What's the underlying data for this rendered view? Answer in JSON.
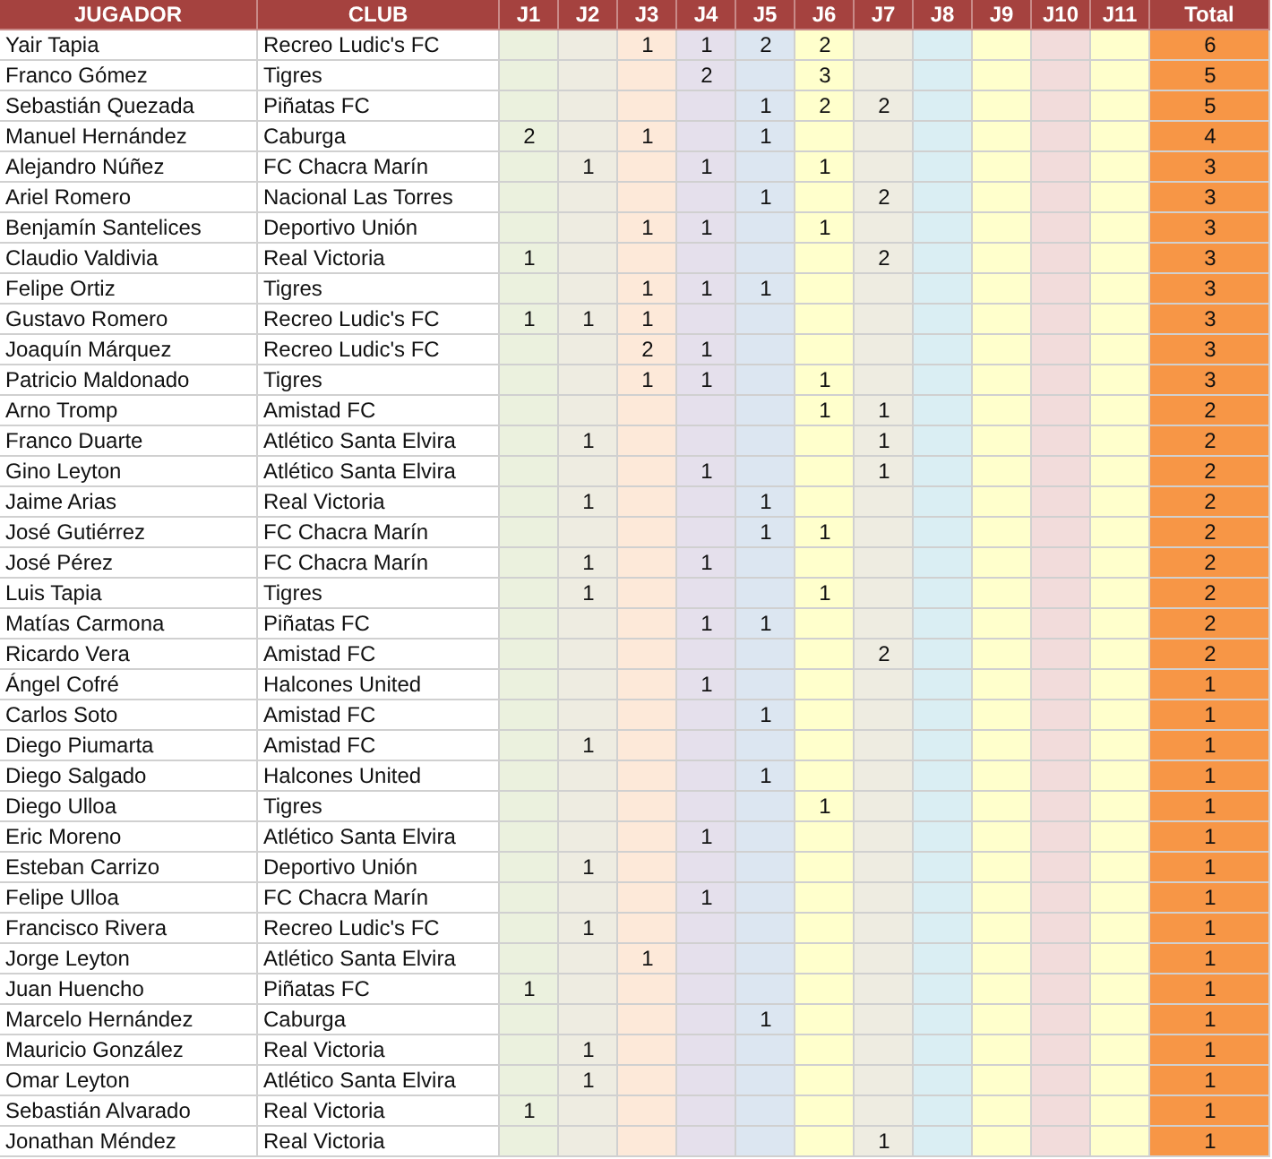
{
  "table": {
    "columns": [
      {
        "label": "JUGADOR"
      },
      {
        "label": "CLUB"
      },
      {
        "label": "J1",
        "color": "#ebf1de"
      },
      {
        "label": "J2",
        "color": "#eeece1"
      },
      {
        "label": "J3",
        "color": "#fde9d9"
      },
      {
        "label": "J4",
        "color": "#e5e0ec"
      },
      {
        "label": "J5",
        "color": "#dce6f1"
      },
      {
        "label": "J6",
        "color": "#ffffcc"
      },
      {
        "label": "J7",
        "color": "#eeece1"
      },
      {
        "label": "J8",
        "color": "#daeef3"
      },
      {
        "label": "J9",
        "color": "#ffffcc"
      },
      {
        "label": "J10",
        "color": "#f2dcdb"
      },
      {
        "label": "J11",
        "color": "#ffffcc"
      },
      {
        "label": "Total",
        "color": "#f79646"
      }
    ],
    "rows": [
      {
        "player": "Yair Tapia",
        "club": "Recreo Ludic's FC",
        "goals": [
          {
            "kind": "blank"
          },
          {
            "kind": "blank"
          },
          {
            "kind": "goals",
            "value": "1"
          },
          {
            "kind": "goals",
            "value": "1"
          },
          {
            "kind": "goals",
            "value": "2"
          },
          {
            "kind": "goals",
            "value": "2"
          },
          {
            "kind": "blank"
          },
          {
            "kind": "blank"
          },
          {
            "kind": "blank"
          },
          {
            "kind": "blank"
          },
          {
            "kind": "blank"
          }
        ],
        "total": "6"
      },
      {
        "player": "Franco Gómez",
        "club": "Tigres",
        "goals": [
          {
            "kind": "blank"
          },
          {
            "kind": "blank"
          },
          {
            "kind": "blank"
          },
          {
            "kind": "goals",
            "value": "2"
          },
          {
            "kind": "blank"
          },
          {
            "kind": "goals",
            "value": "3"
          },
          {
            "kind": "blank"
          },
          {
            "kind": "blank"
          },
          {
            "kind": "blank"
          },
          {
            "kind": "blank"
          },
          {
            "kind": "blank"
          }
        ],
        "total": "5"
      },
      {
        "player": "Sebastián Quezada",
        "club": "Piñatas FC",
        "goals": [
          {
            "kind": "blank"
          },
          {
            "kind": "blank"
          },
          {
            "kind": "blank"
          },
          {
            "kind": "blank"
          },
          {
            "kind": "goals",
            "value": "1"
          },
          {
            "kind": "goals",
            "value": "2"
          },
          {
            "kind": "goals",
            "value": "2"
          },
          {
            "kind": "blank"
          },
          {
            "kind": "blank"
          },
          {
            "kind": "blank"
          },
          {
            "kind": "blank"
          }
        ],
        "total": "5"
      },
      {
        "player": "Manuel Hernández",
        "club": "Caburga",
        "goals": [
          {
            "kind": "goals",
            "value": "2"
          },
          {
            "kind": "blank"
          },
          {
            "kind": "goals",
            "value": "1"
          },
          {
            "kind": "blank"
          },
          {
            "kind": "goals",
            "value": "1"
          },
          {
            "kind": "blank"
          },
          {
            "kind": "blank"
          },
          {
            "kind": "blank"
          },
          {
            "kind": "blank"
          },
          {
            "kind": "blank"
          },
          {
            "kind": "blank"
          }
        ],
        "total": "4"
      },
      {
        "player": "Alejandro Núñez",
        "club": "FC Chacra Marín",
        "goals": [
          {
            "kind": "blank"
          },
          {
            "kind": "goals",
            "value": "1"
          },
          {
            "kind": "blank"
          },
          {
            "kind": "goals",
            "value": "1"
          },
          {
            "kind": "blank"
          },
          {
            "kind": "goals",
            "value": "1"
          },
          {
            "kind": "blank"
          },
          {
            "kind": "blank"
          },
          {
            "kind": "blank"
          },
          {
            "kind": "blank"
          },
          {
            "kind": "blank"
          }
        ],
        "total": "3"
      },
      {
        "player": "Ariel Romero",
        "club": "Nacional Las Torres",
        "goals": [
          {
            "kind": "blank"
          },
          {
            "kind": "blank"
          },
          {
            "kind": "blank"
          },
          {
            "kind": "blank"
          },
          {
            "kind": "goals",
            "value": "1"
          },
          {
            "kind": "blank"
          },
          {
            "kind": "goals",
            "value": "2"
          },
          {
            "kind": "blank"
          },
          {
            "kind": "blank"
          },
          {
            "kind": "blank"
          },
          {
            "kind": "blank"
          }
        ],
        "total": "3"
      },
      {
        "player": "Benjamín Santelices",
        "club": "Deportivo Unión",
        "goals": [
          {
            "kind": "blank"
          },
          {
            "kind": "blank"
          },
          {
            "kind": "goals",
            "value": "1"
          },
          {
            "kind": "goals",
            "value": "1"
          },
          {
            "kind": "blank"
          },
          {
            "kind": "goals",
            "value": "1"
          },
          {
            "kind": "blank"
          },
          {
            "kind": "blank"
          },
          {
            "kind": "blank"
          },
          {
            "kind": "blank"
          },
          {
            "kind": "blank"
          }
        ],
        "total": "3"
      },
      {
        "player": "Claudio Valdivia",
        "club": "Real Victoria",
        "goals": [
          {
            "kind": "goals",
            "value": "1"
          },
          {
            "kind": "blank"
          },
          {
            "kind": "blank"
          },
          {
            "kind": "blank"
          },
          {
            "kind": "blank"
          },
          {
            "kind": "blank"
          },
          {
            "kind": "goals",
            "value": "2"
          },
          {
            "kind": "blank"
          },
          {
            "kind": "blank"
          },
          {
            "kind": "blank"
          },
          {
            "kind": "blank"
          }
        ],
        "total": "3"
      },
      {
        "player": "Felipe Ortiz",
        "club": "Tigres",
        "goals": [
          {
            "kind": "blank"
          },
          {
            "kind": "blank"
          },
          {
            "kind": "goals",
            "value": "1"
          },
          {
            "kind": "goals",
            "value": "1"
          },
          {
            "kind": "goals",
            "value": "1"
          },
          {
            "kind": "blank"
          },
          {
            "kind": "blank"
          },
          {
            "kind": "blank"
          },
          {
            "kind": "blank"
          },
          {
            "kind": "blank"
          },
          {
            "kind": "blank"
          }
        ],
        "total": "3"
      },
      {
        "player": "Gustavo Romero",
        "club": "Recreo Ludic's FC",
        "goals": [
          {
            "kind": "goals",
            "value": "1"
          },
          {
            "kind": "goals",
            "value": "1"
          },
          {
            "kind": "goals",
            "value": "1"
          },
          {
            "kind": "blank"
          },
          {
            "kind": "blank"
          },
          {
            "kind": "blank"
          },
          {
            "kind": "blank"
          },
          {
            "kind": "blank"
          },
          {
            "kind": "blank"
          },
          {
            "kind": "blank"
          },
          {
            "kind": "blank"
          }
        ],
        "total": "3"
      },
      {
        "player": "Joaquín Márquez",
        "club": "Recreo Ludic's FC",
        "goals": [
          {
            "kind": "blank"
          },
          {
            "kind": "blank"
          },
          {
            "kind": "goals",
            "value": "2"
          },
          {
            "kind": "goals",
            "value": "1"
          },
          {
            "kind": "blank"
          },
          {
            "kind": "blank"
          },
          {
            "kind": "blank"
          },
          {
            "kind": "blank"
          },
          {
            "kind": "blank"
          },
          {
            "kind": "blank"
          },
          {
            "kind": "blank"
          }
        ],
        "total": "3"
      },
      {
        "player": "Patricio Maldonado",
        "club": "Tigres",
        "goals": [
          {
            "kind": "blank"
          },
          {
            "kind": "blank"
          },
          {
            "kind": "goals",
            "value": "1"
          },
          {
            "kind": "goals",
            "value": "1"
          },
          {
            "kind": "blank"
          },
          {
            "kind": "goals",
            "value": "1"
          },
          {
            "kind": "blank"
          },
          {
            "kind": "blank"
          },
          {
            "kind": "blank"
          },
          {
            "kind": "blank"
          },
          {
            "kind": "blank"
          }
        ],
        "total": "3"
      },
      {
        "player": "Arno Tromp",
        "club": "Amistad FC",
        "goals": [
          {
            "kind": "blank"
          },
          {
            "kind": "blank"
          },
          {
            "kind": "blank"
          },
          {
            "kind": "blank"
          },
          {
            "kind": "blank"
          },
          {
            "kind": "goals",
            "value": "1"
          },
          {
            "kind": "goals",
            "value": "1"
          },
          {
            "kind": "blank"
          },
          {
            "kind": "blank"
          },
          {
            "kind": "blank"
          },
          {
            "kind": "blank"
          }
        ],
        "total": "2"
      },
      {
        "player": "Franco Duarte",
        "club": "Atlético Santa Elvira",
        "goals": [
          {
            "kind": "blank"
          },
          {
            "kind": "goals",
            "value": "1"
          },
          {
            "kind": "blank"
          },
          {
            "kind": "blank"
          },
          {
            "kind": "blank"
          },
          {
            "kind": "blank"
          },
          {
            "kind": "goals",
            "value": "1"
          },
          {
            "kind": "blank"
          },
          {
            "kind": "blank"
          },
          {
            "kind": "blank"
          },
          {
            "kind": "blank"
          }
        ],
        "total": "2"
      },
      {
        "player": "Gino Leyton",
        "club": "Atlético Santa Elvira",
        "goals": [
          {
            "kind": "blank"
          },
          {
            "kind": "blank"
          },
          {
            "kind": "blank"
          },
          {
            "kind": "goals",
            "value": "1"
          },
          {
            "kind": "blank"
          },
          {
            "kind": "blank"
          },
          {
            "kind": "goals",
            "value": "1"
          },
          {
            "kind": "blank"
          },
          {
            "kind": "blank"
          },
          {
            "kind": "blank"
          },
          {
            "kind": "blank"
          }
        ],
        "total": "2"
      },
      {
        "player": "Jaime Arias",
        "club": "Real Victoria",
        "goals": [
          {
            "kind": "blank"
          },
          {
            "kind": "goals",
            "value": "1"
          },
          {
            "kind": "blank"
          },
          {
            "kind": "blank"
          },
          {
            "kind": "goals",
            "value": "1"
          },
          {
            "kind": "blank"
          },
          {
            "kind": "blank"
          },
          {
            "kind": "blank"
          },
          {
            "kind": "blank"
          },
          {
            "kind": "blank"
          },
          {
            "kind": "blank"
          }
        ],
        "total": "2"
      },
      {
        "player": "José Gutiérrez",
        "club": "FC Chacra Marín",
        "goals": [
          {
            "kind": "blank"
          },
          {
            "kind": "blank"
          },
          {
            "kind": "blank"
          },
          {
            "kind": "blank"
          },
          {
            "kind": "goals",
            "value": "1"
          },
          {
            "kind": "goals",
            "value": "1"
          },
          {
            "kind": "blank"
          },
          {
            "kind": "blank"
          },
          {
            "kind": "blank"
          },
          {
            "kind": "blank"
          },
          {
            "kind": "blank"
          }
        ],
        "total": "2"
      },
      {
        "player": "José Pérez",
        "club": "FC Chacra Marín",
        "goals": [
          {
            "kind": "blank"
          },
          {
            "kind": "goals",
            "value": "1"
          },
          {
            "kind": "blank"
          },
          {
            "kind": "goals",
            "value": "1"
          },
          {
            "kind": "blank"
          },
          {
            "kind": "blank"
          },
          {
            "kind": "blank"
          },
          {
            "kind": "blank"
          },
          {
            "kind": "blank"
          },
          {
            "kind": "blank"
          },
          {
            "kind": "blank"
          }
        ],
        "total": "2"
      },
      {
        "player": "Luis Tapia",
        "club": "Tigres",
        "goals": [
          {
            "kind": "blank"
          },
          {
            "kind": "goals",
            "value": "1"
          },
          {
            "kind": "blank"
          },
          {
            "kind": "blank"
          },
          {
            "kind": "blank"
          },
          {
            "kind": "goals",
            "value": "1"
          },
          {
            "kind": "blank"
          },
          {
            "kind": "blank"
          },
          {
            "kind": "blank"
          },
          {
            "kind": "blank"
          },
          {
            "kind": "blank"
          }
        ],
        "total": "2"
      },
      {
        "player": "Matías Carmona",
        "club": "Piñatas FC",
        "goals": [
          {
            "kind": "blank"
          },
          {
            "kind": "blank"
          },
          {
            "kind": "blank"
          },
          {
            "kind": "goals",
            "value": "1"
          },
          {
            "kind": "goals",
            "value": "1"
          },
          {
            "kind": "blank"
          },
          {
            "kind": "blank"
          },
          {
            "kind": "blank"
          },
          {
            "kind": "blank"
          },
          {
            "kind": "blank"
          },
          {
            "kind": "blank"
          }
        ],
        "total": "2"
      },
      {
        "player": "Ricardo Vera",
        "club": "Amistad FC",
        "goals": [
          {
            "kind": "blank"
          },
          {
            "kind": "blank"
          },
          {
            "kind": "blank"
          },
          {
            "kind": "blank"
          },
          {
            "kind": "blank"
          },
          {
            "kind": "blank"
          },
          {
            "kind": "goals",
            "value": "2"
          },
          {
            "kind": "blank"
          },
          {
            "kind": "blank"
          },
          {
            "kind": "blank"
          },
          {
            "kind": "blank"
          }
        ],
        "total": "2"
      },
      {
        "player": "Ángel Cofré",
        "club": "Halcones United",
        "goals": [
          {
            "kind": "blank"
          },
          {
            "kind": "blank"
          },
          {
            "kind": "blank"
          },
          {
            "kind": "goals",
            "value": "1"
          },
          {
            "kind": "blank"
          },
          {
            "kind": "blank"
          },
          {
            "kind": "blank"
          },
          {
            "kind": "blank"
          },
          {
            "kind": "blank"
          },
          {
            "kind": "blank"
          },
          {
            "kind": "blank"
          }
        ],
        "total": "1"
      },
      {
        "player": "Carlos Soto",
        "club": "Amistad FC",
        "goals": [
          {
            "kind": "blank"
          },
          {
            "kind": "blank"
          },
          {
            "kind": "blank"
          },
          {
            "kind": "blank"
          },
          {
            "kind": "goals",
            "value": "1"
          },
          {
            "kind": "blank"
          },
          {
            "kind": "blank"
          },
          {
            "kind": "blank"
          },
          {
            "kind": "blank"
          },
          {
            "kind": "blank"
          },
          {
            "kind": "blank"
          }
        ],
        "total": "1"
      },
      {
        "player": "Diego Piumarta",
        "club": "Amistad FC",
        "goals": [
          {
            "kind": "blank"
          },
          {
            "kind": "goals",
            "value": "1"
          },
          {
            "kind": "blank"
          },
          {
            "kind": "blank"
          },
          {
            "kind": "blank"
          },
          {
            "kind": "blank"
          },
          {
            "kind": "blank"
          },
          {
            "kind": "blank"
          },
          {
            "kind": "blank"
          },
          {
            "kind": "blank"
          },
          {
            "kind": "blank"
          }
        ],
        "total": "1"
      },
      {
        "player": "Diego Salgado",
        "club": "Halcones United",
        "goals": [
          {
            "kind": "blank"
          },
          {
            "kind": "blank"
          },
          {
            "kind": "blank"
          },
          {
            "kind": "blank"
          },
          {
            "kind": "goals",
            "value": "1"
          },
          {
            "kind": "blank"
          },
          {
            "kind": "blank"
          },
          {
            "kind": "blank"
          },
          {
            "kind": "blank"
          },
          {
            "kind": "blank"
          },
          {
            "kind": "blank"
          }
        ],
        "total": "1"
      },
      {
        "player": "Diego Ulloa",
        "club": "Tigres",
        "goals": [
          {
            "kind": "blank"
          },
          {
            "kind": "blank"
          },
          {
            "kind": "blank"
          },
          {
            "kind": "blank"
          },
          {
            "kind": "blank"
          },
          {
            "kind": "goals",
            "value": "1"
          },
          {
            "kind": "blank"
          },
          {
            "kind": "blank"
          },
          {
            "kind": "blank"
          },
          {
            "kind": "blank"
          },
          {
            "kind": "blank"
          }
        ],
        "total": "1"
      },
      {
        "player": "Eric Moreno",
        "club": "Atlético Santa Elvira",
        "goals": [
          {
            "kind": "blank"
          },
          {
            "kind": "blank"
          },
          {
            "kind": "blank"
          },
          {
            "kind": "goals",
            "value": "1"
          },
          {
            "kind": "blank"
          },
          {
            "kind": "blank"
          },
          {
            "kind": "blank"
          },
          {
            "kind": "blank"
          },
          {
            "kind": "blank"
          },
          {
            "kind": "blank"
          },
          {
            "kind": "blank"
          }
        ],
        "total": "1"
      },
      {
        "player": "Esteban Carrizo",
        "club": "Deportivo Unión",
        "goals": [
          {
            "kind": "blank"
          },
          {
            "kind": "goals",
            "value": "1"
          },
          {
            "kind": "blank"
          },
          {
            "kind": "blank"
          },
          {
            "kind": "blank"
          },
          {
            "kind": "blank"
          },
          {
            "kind": "blank"
          },
          {
            "kind": "blank"
          },
          {
            "kind": "blank"
          },
          {
            "kind": "blank"
          },
          {
            "kind": "blank"
          }
        ],
        "total": "1"
      },
      {
        "player": "Felipe Ulloa",
        "club": "FC Chacra Marín",
        "goals": [
          {
            "kind": "blank"
          },
          {
            "kind": "blank"
          },
          {
            "kind": "blank"
          },
          {
            "kind": "goals",
            "value": "1"
          },
          {
            "kind": "blank"
          },
          {
            "kind": "blank"
          },
          {
            "kind": "blank"
          },
          {
            "kind": "blank"
          },
          {
            "kind": "blank"
          },
          {
            "kind": "blank"
          },
          {
            "kind": "blank"
          }
        ],
        "total": "1"
      },
      {
        "player": "Francisco Rivera",
        "club": "Recreo Ludic's FC",
        "goals": [
          {
            "kind": "blank"
          },
          {
            "kind": "goals",
            "value": "1"
          },
          {
            "kind": "blank"
          },
          {
            "kind": "blank"
          },
          {
            "kind": "blank"
          },
          {
            "kind": "blank"
          },
          {
            "kind": "blank"
          },
          {
            "kind": "blank"
          },
          {
            "kind": "blank"
          },
          {
            "kind": "blank"
          },
          {
            "kind": "blank"
          }
        ],
        "total": "1"
      },
      {
        "player": "Jorge Leyton",
        "club": "Atlético Santa Elvira",
        "goals": [
          {
            "kind": "blank"
          },
          {
            "kind": "blank"
          },
          {
            "kind": "goals",
            "value": "1"
          },
          {
            "kind": "blank"
          },
          {
            "kind": "blank"
          },
          {
            "kind": "blank"
          },
          {
            "kind": "blank"
          },
          {
            "kind": "blank"
          },
          {
            "kind": "blank"
          },
          {
            "kind": "blank"
          },
          {
            "kind": "blank"
          }
        ],
        "total": "1"
      },
      {
        "player": "Juan Huencho",
        "club": "Piñatas FC",
        "goals": [
          {
            "kind": "goals",
            "value": "1"
          },
          {
            "kind": "blank"
          },
          {
            "kind": "blank"
          },
          {
            "kind": "blank"
          },
          {
            "kind": "blank"
          },
          {
            "kind": "blank"
          },
          {
            "kind": "blank"
          },
          {
            "kind": "blank"
          },
          {
            "kind": "blank"
          },
          {
            "kind": "blank"
          },
          {
            "kind": "blank"
          }
        ],
        "total": "1"
      },
      {
        "player": "Marcelo Hernández",
        "club": "Caburga",
        "goals": [
          {
            "kind": "blank"
          },
          {
            "kind": "blank"
          },
          {
            "kind": "blank"
          },
          {
            "kind": "blank"
          },
          {
            "kind": "goals",
            "value": "1"
          },
          {
            "kind": "blank"
          },
          {
            "kind": "blank"
          },
          {
            "kind": "blank"
          },
          {
            "kind": "blank"
          },
          {
            "kind": "blank"
          },
          {
            "kind": "blank"
          }
        ],
        "total": "1"
      },
      {
        "player": "Mauricio González",
        "club": "Real Victoria",
        "goals": [
          {
            "kind": "blank"
          },
          {
            "kind": "goals",
            "value": "1"
          },
          {
            "kind": "blank"
          },
          {
            "kind": "blank"
          },
          {
            "kind": "blank"
          },
          {
            "kind": "blank"
          },
          {
            "kind": "blank"
          },
          {
            "kind": "blank"
          },
          {
            "kind": "blank"
          },
          {
            "kind": "blank"
          },
          {
            "kind": "blank"
          }
        ],
        "total": "1"
      },
      {
        "player": "Omar Leyton",
        "club": "Atlético Santa Elvira",
        "goals": [
          {
            "kind": "blank"
          },
          {
            "kind": "goals",
            "value": "1"
          },
          {
            "kind": "blank"
          },
          {
            "kind": "blank"
          },
          {
            "kind": "blank"
          },
          {
            "kind": "blank"
          },
          {
            "kind": "blank"
          },
          {
            "kind": "blank"
          },
          {
            "kind": "blank"
          },
          {
            "kind": "blank"
          },
          {
            "kind": "blank"
          }
        ],
        "total": "1"
      },
      {
        "player": "Sebastián Alvarado",
        "club": "Real Victoria",
        "goals": [
          {
            "kind": "goals",
            "value": "1"
          },
          {
            "kind": "blank"
          },
          {
            "kind": "blank"
          },
          {
            "kind": "blank"
          },
          {
            "kind": "blank"
          },
          {
            "kind": "blank"
          },
          {
            "kind": "blank"
          },
          {
            "kind": "blank"
          },
          {
            "kind": "blank"
          },
          {
            "kind": "blank"
          },
          {
            "kind": "blank"
          }
        ],
        "total": "1"
      },
      {
        "player": "Jonathan Méndez",
        "club": "Real Victoria",
        "goals": [
          {
            "kind": "blank"
          },
          {
            "kind": "blank"
          },
          {
            "kind": "blank"
          },
          {
            "kind": "blank"
          },
          {
            "kind": "blank"
          },
          {
            "kind": "blank"
          },
          {
            "kind": "goals",
            "value": "1"
          },
          {
            "kind": "blank"
          },
          {
            "kind": "blank"
          },
          {
            "kind": "blank"
          },
          {
            "kind": "blank"
          }
        ],
        "total": "1"
      }
    ]
  }
}
